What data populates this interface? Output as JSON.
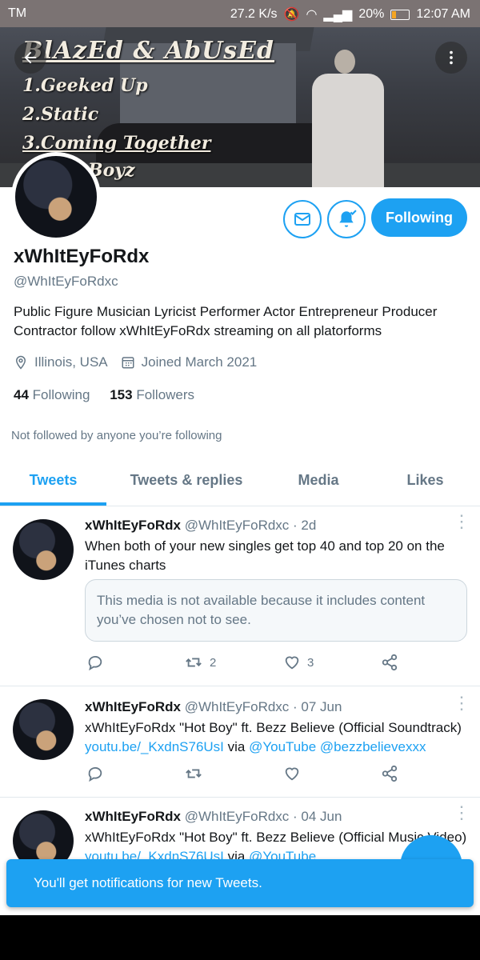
{
  "status_bar": {
    "carrier": "TM",
    "speed": "27.2 K/s",
    "battery": "20%",
    "time": "12:07 AM"
  },
  "banner": {
    "lines": [
      "BlAzEd & AbUsEd",
      "1.Geeked Up",
      "2.Static",
      "3.Coming Together",
      "Boyz"
    ]
  },
  "profile": {
    "name": "xWhItEyFoRdx",
    "handle": "@WhItEyFoRdxc",
    "bio": "Public Figure Musician Lyricist Performer Actor Entrepreneur Producer Contractor follow xWhItEyFoRdx streaming on all platorforms",
    "location": "Illinois, USA",
    "joined": "Joined March 2021",
    "following_count": "44",
    "following_label": "Following",
    "followers_count": "153",
    "followers_label": "Followers",
    "not_followed": "Not followed by anyone you’re following",
    "follow_button": "Following"
  },
  "tabs": [
    {
      "label": "Tweets",
      "active": true
    },
    {
      "label": "Tweets & replies",
      "active": false
    },
    {
      "label": "Media",
      "active": false
    },
    {
      "label": "Likes",
      "active": false
    }
  ],
  "tweets": [
    {
      "name": "xWhItEyFoRdx",
      "handle_date": "@WhItEyFoRdxc · 2d",
      "text": "When both of your new singles get top 40 and top 20 on the iTunes charts",
      "media_notice": "This media is not available because it includes content you’ve chosen not to see.",
      "retweets": "2",
      "likes": "3"
    },
    {
      "name": "xWhItEyFoRdx",
      "handle_date": "@WhItEyFoRdxc · 07 Jun",
      "text": "xWhItEyFoRdx \"Hot Boy\" ft. Bezz Believe (Official Soundtrack)",
      "link": "youtu.be/_KxdnS76UsI",
      "via": "via",
      "mention1": "@YouTube",
      "mention2": "@bezzbelievexxx"
    },
    {
      "name": "xWhItEyFoRdx",
      "handle_date": "@WhItEyFoRdxc · 04 Jun",
      "text": "xWhItEyFoRdx \"Hot Boy\" ft. Bezz Believe (Official Music Video)",
      "link": "youtu.be/_KxdnS76UsI",
      "via": "via",
      "mention1": "@YouTube"
    }
  ],
  "toast": {
    "message": "You'll get notifications for new Tweets."
  },
  "colors": {
    "accent": "#1da1f2",
    "muted": "#657786"
  }
}
